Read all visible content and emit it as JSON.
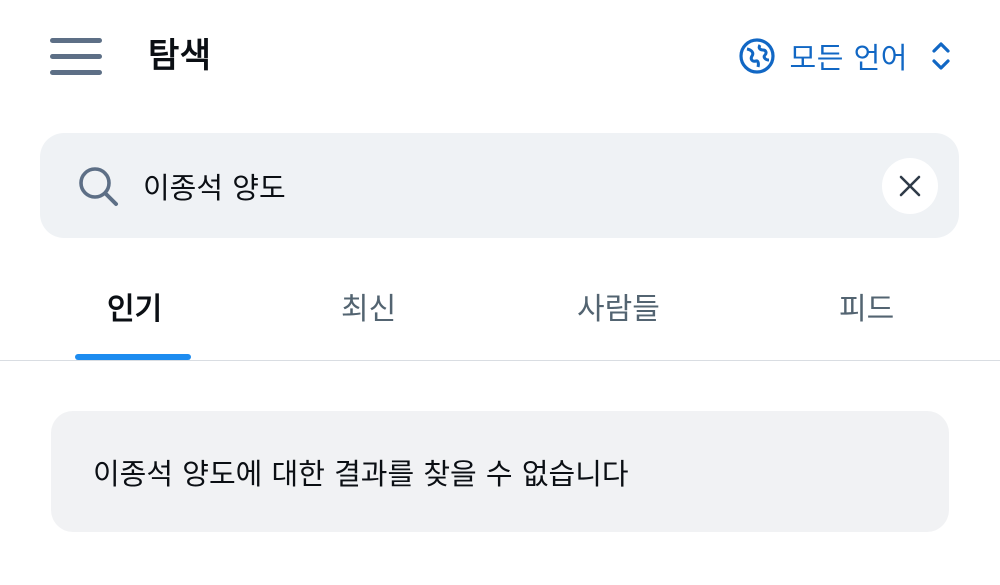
{
  "header": {
    "title": "탐색",
    "language_label": "모든 언어",
    "accent_color": "#1167c4"
  },
  "search": {
    "value": "이종석 양도",
    "placeholder": ""
  },
  "tabs": [
    {
      "label": "인기",
      "active": true
    },
    {
      "label": "최신",
      "active": false
    },
    {
      "label": "사람들",
      "active": false
    },
    {
      "label": "피드",
      "active": false
    }
  ],
  "results": {
    "empty_message": "이종석 양도에 대한 결과를 찾을 수 없습니다"
  },
  "icons": {
    "menu": "hamburger-menu-icon",
    "language": "globe-icon",
    "language_toggle": "chevron-up-down-icon",
    "search": "search-icon",
    "clear": "close-icon"
  },
  "colors": {
    "tab_indicator": "#1d8cf0",
    "search_background": "#eff2f5",
    "menu_icon": "#5d6f86"
  }
}
